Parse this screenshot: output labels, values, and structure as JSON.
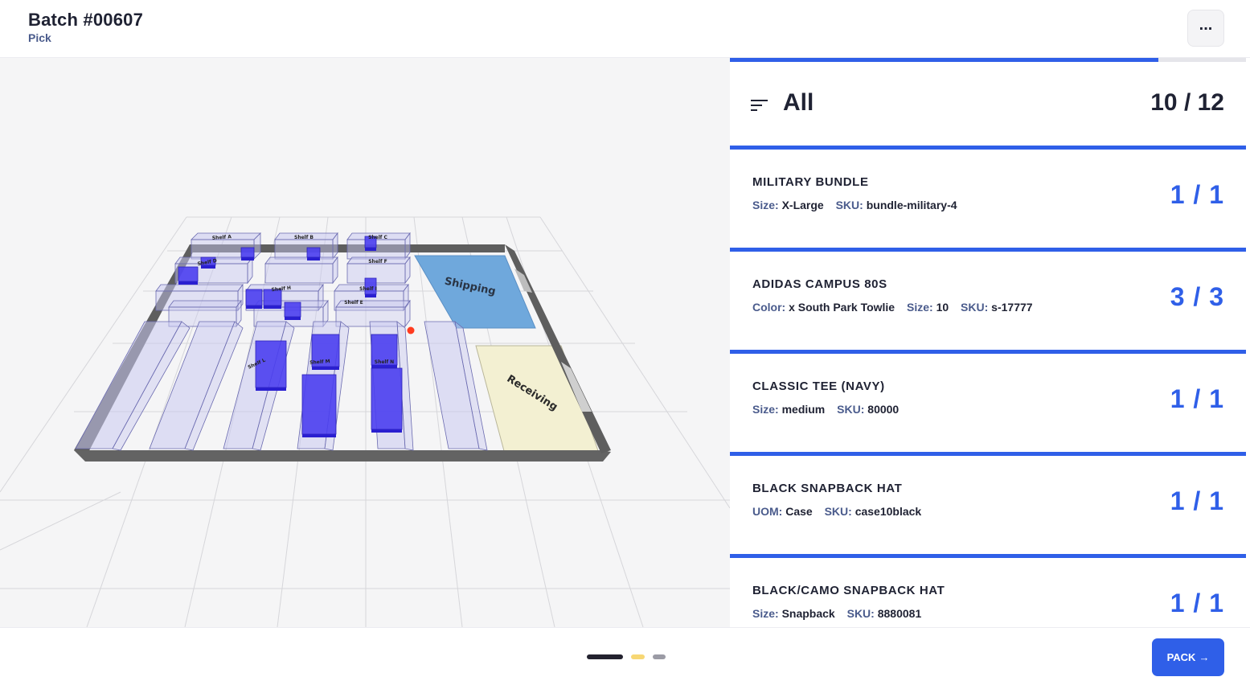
{
  "header": {
    "title": "Batch #00607",
    "subtitle": "Pick",
    "more_label": "..."
  },
  "map": {
    "shelves": [
      "Shelf A",
      "Shelf B",
      "Shelf C",
      "Shelf D",
      "Shelf E",
      "Shelf F",
      "Shelf H",
      "Shelf I",
      "Shelf L",
      "Shelf M",
      "Shelf N"
    ],
    "zones": [
      "Shipping",
      "Receiving"
    ],
    "colors": {
      "shelf": "#c8c8f0",
      "stock": "#4b3ff0",
      "shipping": "#6fa8dc",
      "receiving": "#f3f0d2",
      "wall": "#6a6a6a",
      "marker": "#ff3b1f"
    }
  },
  "list": {
    "filter_icon": "filter-lines-icon",
    "filter_label": "All",
    "progress_text": "10 / 12",
    "progress_fraction": 0.83,
    "items": [
      {
        "name": "MILITARY BUNDLE",
        "attrs": [
          {
            "key": "Size:",
            "value": "X-Large"
          },
          {
            "key": "SKU:",
            "value": "bundle-military-4"
          }
        ],
        "qty": "1 / 1"
      },
      {
        "name": "ADIDAS CAMPUS 80S",
        "attrs": [
          {
            "key": "Color:",
            "value": "x South Park Towlie"
          },
          {
            "key": "Size:",
            "value": "10"
          },
          {
            "key": "SKU:",
            "value": "s-17777"
          }
        ],
        "qty": "3 / 3"
      },
      {
        "name": "CLASSIC TEE (NAVY)",
        "attrs": [
          {
            "key": "Size:",
            "value": "medium"
          },
          {
            "key": "SKU:",
            "value": "80000"
          }
        ],
        "qty": "1 / 1"
      },
      {
        "name": "BLACK SNAPBACK HAT",
        "attrs": [
          {
            "key": "UOM:",
            "value": "Case"
          },
          {
            "key": "SKU:",
            "value": "case10black"
          }
        ],
        "qty": "1 / 1"
      },
      {
        "name": "BLACK/CAMO SNAPBACK HAT",
        "attrs": [
          {
            "key": "Size:",
            "value": "Snapback"
          },
          {
            "key": "SKU:",
            "value": "8880081"
          }
        ],
        "qty": "1 / 1"
      }
    ]
  },
  "footer": {
    "page_dots": [
      {
        "state": "active",
        "color": "#23222f"
      },
      {
        "state": "pending",
        "color": "#f7d774"
      },
      {
        "state": "inactive",
        "color": "#9b9ba5"
      }
    ],
    "pack_label": "PACK",
    "pack_icon": "arrow-right-icon",
    "pack_arrow": "→"
  }
}
